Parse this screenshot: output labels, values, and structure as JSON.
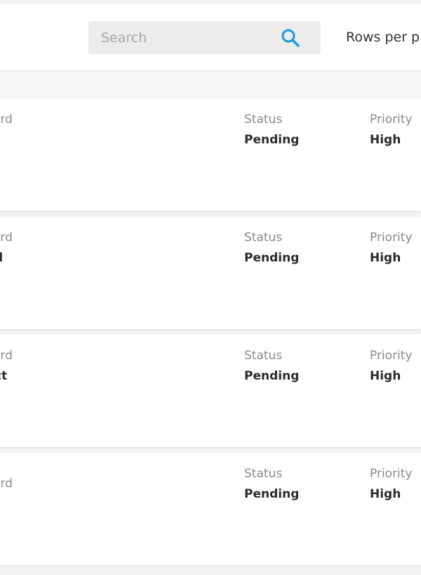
{
  "toolbar": {
    "search_placeholder": "Search",
    "rows_per_page_label": "Rows per p"
  },
  "colors": {
    "search_icon": "#1a9bdc",
    "page_background": "#f4f4f4",
    "card_background": "#ffffff"
  },
  "records": [
    {
      "record_label": "ord",
      "record_value": "",
      "status_label": "Status",
      "status_value": "Pending",
      "priority_label": "Priority",
      "priority_value": "High"
    },
    {
      "record_label": "ord",
      "record_value": "d",
      "status_label": "Status",
      "status_value": "Pending",
      "priority_label": "Priority",
      "priority_value": "High"
    },
    {
      "record_label": "ord",
      "record_value": "ct",
      "status_label": "Status",
      "status_value": "Pending",
      "priority_label": "Priority",
      "priority_value": "High"
    },
    {
      "record_label": "",
      "record_value": "ord",
      "status_label": "Status",
      "status_value": "Pending",
      "priority_label": "Priority",
      "priority_value": "High"
    }
  ]
}
